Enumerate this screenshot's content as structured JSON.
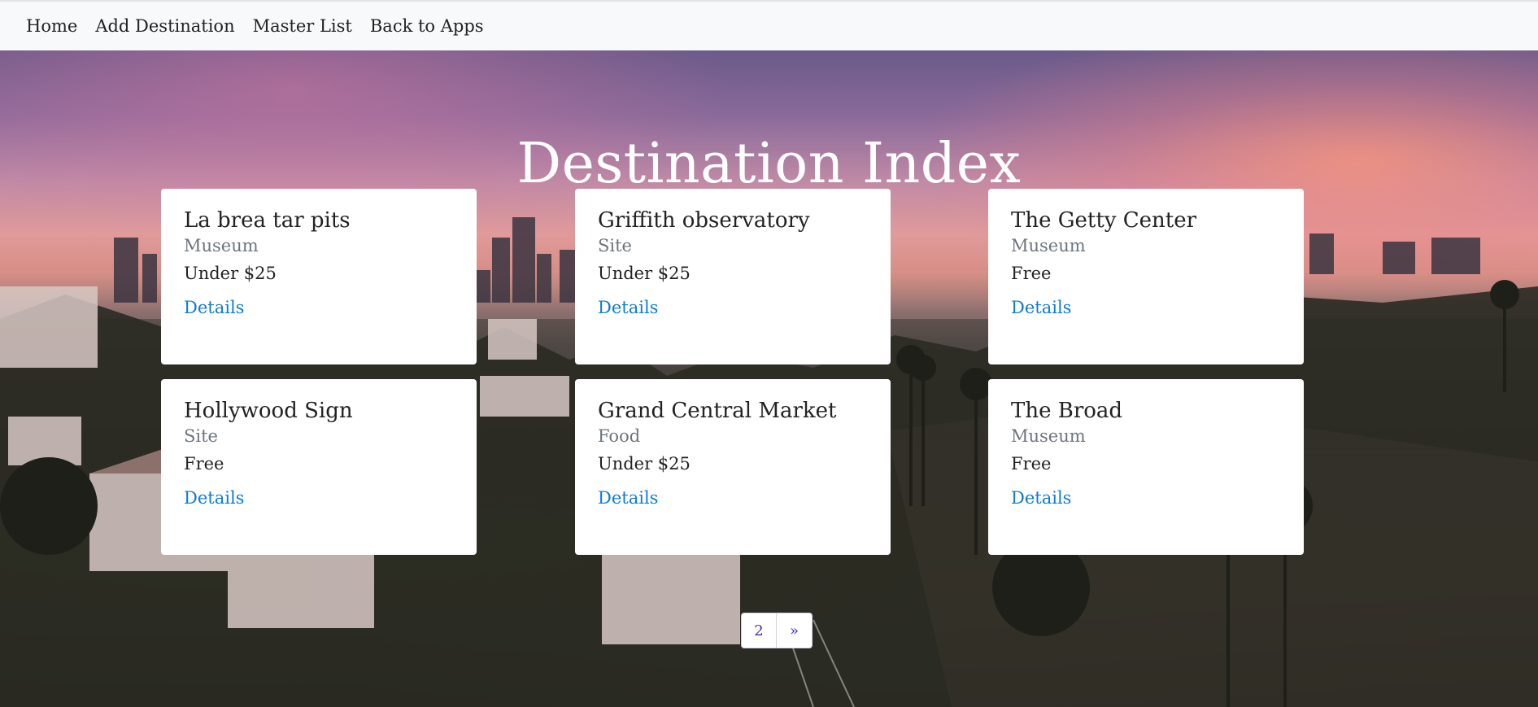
{
  "nav": {
    "items": [
      {
        "label": "Home"
      },
      {
        "label": "Add Destination"
      },
      {
        "label": "Master List"
      },
      {
        "label": "Back to Apps"
      }
    ]
  },
  "hero": {
    "title": "Destination Index",
    "background": "Los Angeles sunset skyline with lake and palm trees"
  },
  "cards": [
    {
      "title": "La brea tar pits",
      "category": "Museum",
      "price": "Under $25",
      "link": "Details"
    },
    {
      "title": "Griffith observatory",
      "category": "Site",
      "price": "Under $25",
      "link": "Details"
    },
    {
      "title": "The Getty Center",
      "category": "Museum",
      "price": "Free",
      "link": "Details"
    },
    {
      "title": "Hollywood Sign",
      "category": "Site",
      "price": "Free",
      "link": "Details"
    },
    {
      "title": "Grand Central Market",
      "category": "Food",
      "price": "Under $25",
      "link": "Details"
    },
    {
      "title": "The Broad",
      "category": "Museum",
      "price": "Free",
      "link": "Details"
    }
  ],
  "pagination": {
    "current": "2",
    "next": "»"
  },
  "colors": {
    "navbar_bg": "#f8f9fa",
    "link": "#0d7bd8",
    "subtitle": "#6c757d",
    "pagination_text": "#3a2fb0"
  }
}
